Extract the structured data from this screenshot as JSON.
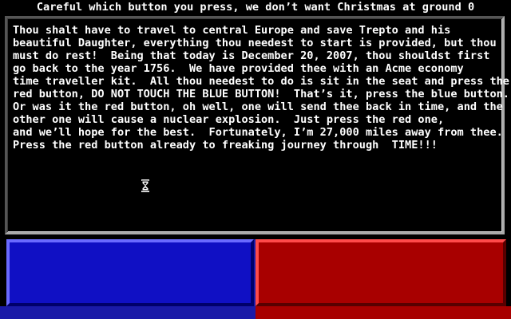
{
  "title": "Careful which button you press, we don’t want Christmas at ground 0",
  "message_lines": [
    "Thou shalt have to travel to central Europe and save Trepto and his",
    "beautiful Daughter, everything thou needest to start is provided, but thou",
    "must do rest!  Being that today is December 20, 2007, thou shouldst first",
    "go back to the year 1756.  We have provided thee with an Acme economy",
    "time traveller kit.  All thou needest to do is sit in the seat and press the",
    "red button, DO NOT TOUCH THE BLUE BUTTON!  That’s it, press the blue button.",
    "Or was it the red button, oh well, one will send thee back in time, and the",
    "other one will cause a nuclear explosion.  Just press the red one,",
    "and we’ll hope for the best.  Fortunately, I’m 27,000 miles away from thee.",
    "Press the red button already to freaking journey through  TIME!!!"
  ],
  "buttons": {
    "blue": {
      "color": "#1010c4"
    },
    "red": {
      "color": "#a80000"
    }
  },
  "cursor_icon": "hourglass-icon"
}
